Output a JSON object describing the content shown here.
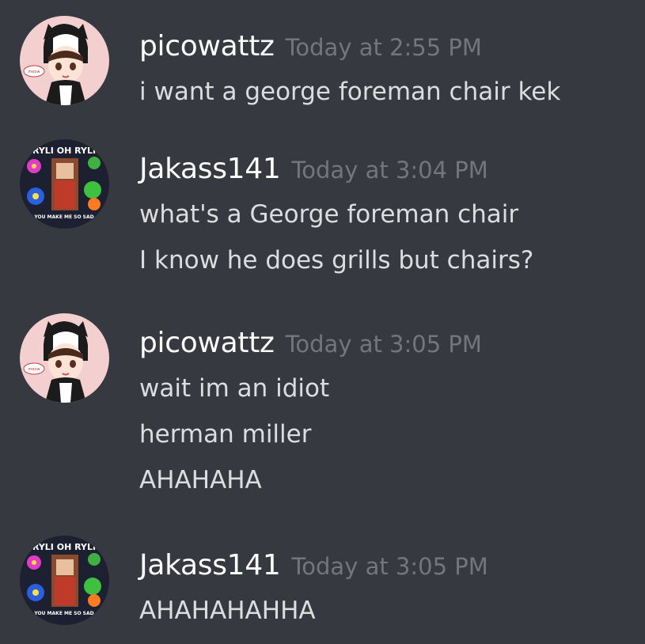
{
  "messages": [
    {
      "author": "picowattz",
      "timestamp": "Today at 2:55 PM",
      "avatar_icon": "anime-girl-cat-hat-avatar",
      "lines": [
        "i want a george foreman chair kek"
      ]
    },
    {
      "author": "Jakass141",
      "timestamp": "Today at 3:04 PM",
      "avatar_icon": "ryli-oh-ryli-flower-avatar",
      "lines": [
        "what's a George foreman chair",
        "I know he does grills but chairs?"
      ]
    },
    {
      "author": "picowattz",
      "timestamp": "Today at 3:05 PM",
      "avatar_icon": "anime-girl-cat-hat-avatar",
      "lines": [
        "wait im an idiot",
        "herman miller",
        "AHAHAHA"
      ]
    },
    {
      "author": "Jakass141",
      "timestamp": "Today at 3:05 PM",
      "avatar_icon": "ryli-oh-ryli-flower-avatar",
      "lines": [
        "AHAHAHAHHA"
      ]
    }
  ],
  "avatar_text": {
    "ryli_top": "RYLI OH RYLI",
    "ryli_bottom": "YOU MAKE ME SO SAD",
    "girl_bubble": "meow"
  },
  "colors": {
    "background": "#36393f",
    "username": "#ffffff",
    "timestamp": "#72767d",
    "message_text": "#dcddde"
  }
}
